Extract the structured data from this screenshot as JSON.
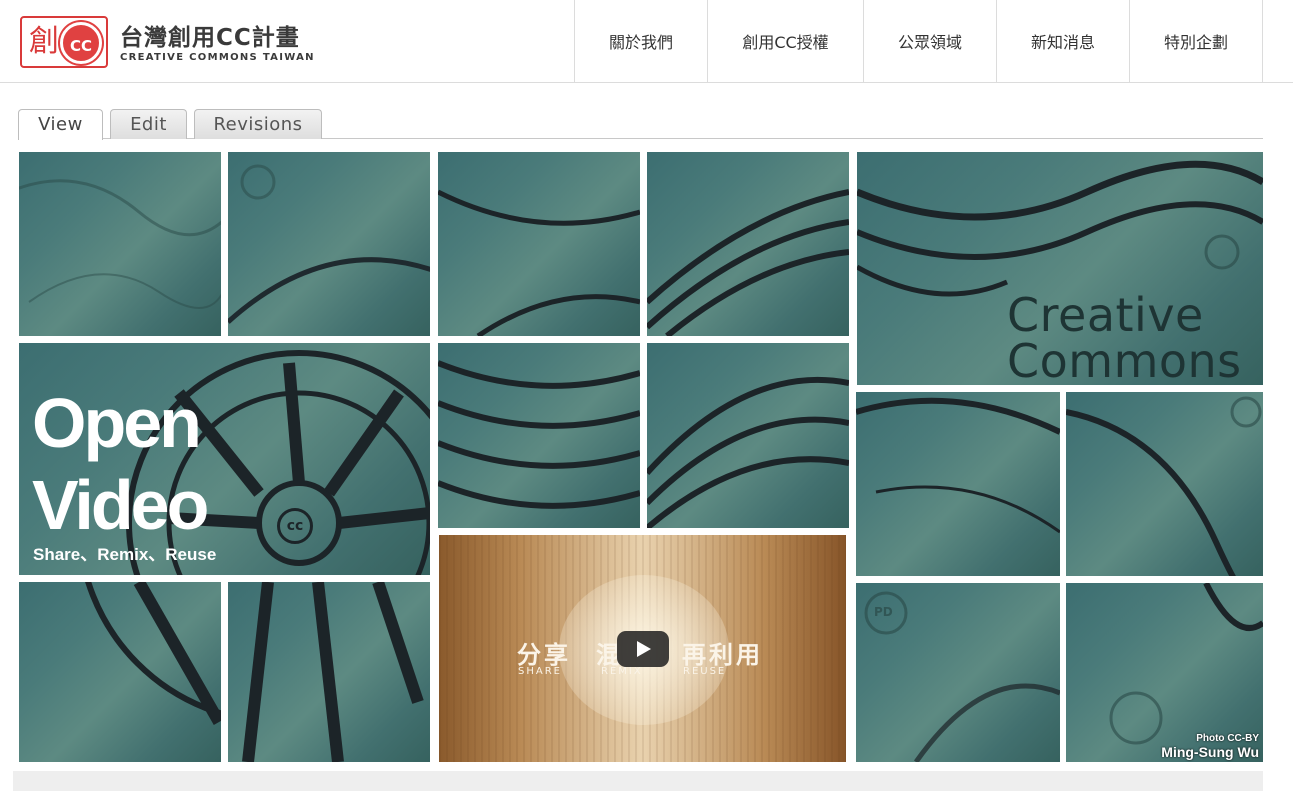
{
  "header": {
    "logo_seal": "創",
    "logo_cc": "CC",
    "logo_title": "台灣創用CC計畫",
    "logo_subtitle": "CREATIVE COMMONS TAIWAN"
  },
  "nav": {
    "items": [
      {
        "label": "關於我們"
      },
      {
        "label": "創用CC授權"
      },
      {
        "label": "公眾領域"
      },
      {
        "label": "新知消息"
      },
      {
        "label": "特別企劃"
      }
    ]
  },
  "tabs": [
    {
      "label": "View",
      "active": true
    },
    {
      "label": "Edit",
      "active": false
    },
    {
      "label": "Revisions",
      "active": false
    }
  ],
  "banner": {
    "headline_line1": "Open",
    "headline_line2": "Video",
    "tagline": "Share、Remix、Reuse",
    "brand_line1": "Creative",
    "brand_line2": "Commons",
    "wheel_badge": "cc",
    "pd_badge": "PD",
    "credit_line1": "Photo CC-BY",
    "credit_line2": "Ming-Sung Wu"
  },
  "video": {
    "word1": "分享",
    "word1_sub": "SHARE",
    "word2": "混",
    "word2_sub": "REMIX",
    "word3": "再利用",
    "word3_sub": "REUSE",
    "play_icon": "play-icon"
  },
  "colors": {
    "brand_red": "#d93a3a",
    "tile_teal": "#4a7b7a",
    "nav_border": "#dcdcdc"
  }
}
